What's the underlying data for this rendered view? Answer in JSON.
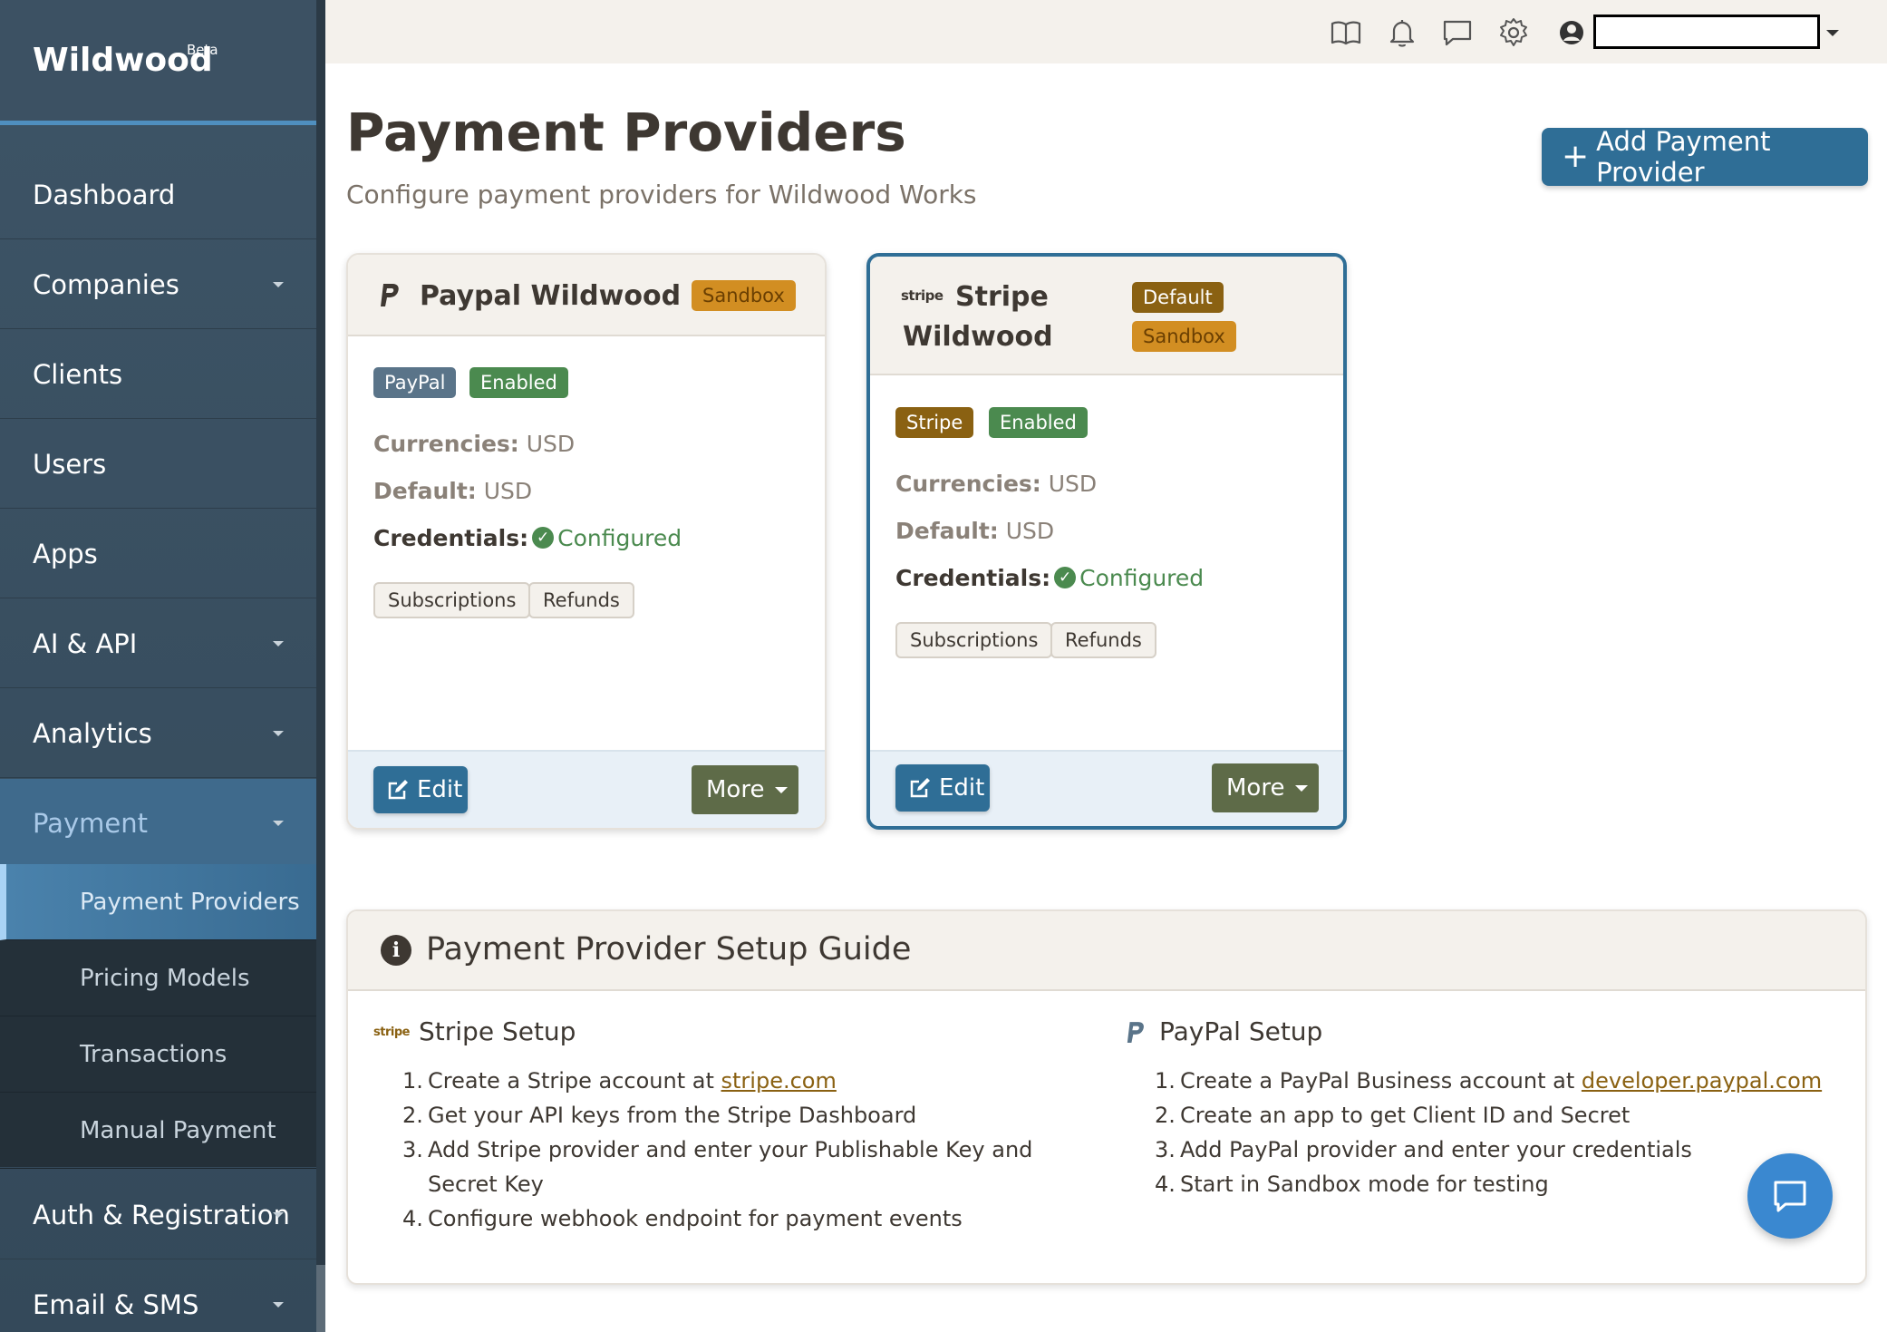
{
  "app": {
    "name": "Wildwood",
    "badge": "Beta"
  },
  "sidebar": {
    "items": [
      {
        "label": "Dashboard"
      },
      {
        "label": "Companies"
      },
      {
        "label": "Clients"
      },
      {
        "label": "Users"
      },
      {
        "label": "Apps"
      },
      {
        "label": "AI & API"
      },
      {
        "label": "Analytics"
      },
      {
        "label": "Payment"
      },
      {
        "label": "Auth & Registration"
      },
      {
        "label": "Email & SMS"
      }
    ],
    "payment_subitems": [
      {
        "label": "Payment Providers"
      },
      {
        "label": "Pricing Models"
      },
      {
        "label": "Transactions"
      },
      {
        "label": "Manual Payment"
      }
    ]
  },
  "topbar": {
    "icons": [
      "book-icon",
      "bell-icon",
      "chat-icon",
      "gear-icon",
      "user-icon"
    ]
  },
  "header": {
    "title": "Payment Providers",
    "subtitle": "Configure payment providers for Wildwood Works",
    "add_button": "Add Payment Provider"
  },
  "providers": [
    {
      "name": "Paypal Wildwood",
      "env_badge": "Sandbox",
      "type_badge": "PayPal",
      "status_badge": "Enabled",
      "currencies_label": "Currencies:",
      "currencies": "USD",
      "default_label": "Default:",
      "default": "USD",
      "credentials_label": "Credentials:",
      "credentials": "Configured",
      "features": [
        "Subscriptions",
        "Refunds"
      ],
      "edit_label": "Edit",
      "more_label": "More"
    },
    {
      "name_line1": "Stripe",
      "name_line2": "Wildwood",
      "logo_text": "stripe",
      "default_badge": "Default",
      "env_badge": "Sandbox",
      "type_badge": "Stripe",
      "status_badge": "Enabled",
      "currencies_label": "Currencies:",
      "currencies": "USD",
      "default_label": "Default:",
      "default": "USD",
      "credentials_label": "Credentials:",
      "credentials": "Configured",
      "features": [
        "Subscriptions",
        "Refunds"
      ],
      "edit_label": "Edit",
      "more_label": "More"
    }
  ],
  "guide": {
    "title": "Payment Provider Setup Guide",
    "stripe": {
      "logo_text": "stripe",
      "title": "Stripe Setup",
      "steps": [
        {
          "num": "1.",
          "text": "Create a Stripe account at ",
          "link": "stripe.com"
        },
        {
          "num": "2.",
          "text": "Get your API keys from the Stripe Dashboard"
        },
        {
          "num": "3.",
          "text": "Add Stripe provider and enter your Publishable Key and Secret Key"
        },
        {
          "num": "4.",
          "text": "Configure webhook endpoint for payment events"
        }
      ]
    },
    "paypal": {
      "title": "PayPal Setup",
      "steps": [
        {
          "num": "1.",
          "text": "Create a PayPal Business account at ",
          "link": "developer.paypal.com"
        },
        {
          "num": "2.",
          "text": "Create an app to get Client ID and Secret"
        },
        {
          "num": "3.",
          "text": "Add PayPal provider and enter your credentials"
        },
        {
          "num": "4.",
          "text": "Start in Sandbox mode for testing"
        }
      ]
    }
  },
  "colors": {
    "primary": "#2f6e96",
    "sidebar": "#3d5466",
    "sandbox": "#d28e22",
    "default": "#8a6112",
    "enabled": "#4b8a4f",
    "more": "#5e6b48"
  }
}
